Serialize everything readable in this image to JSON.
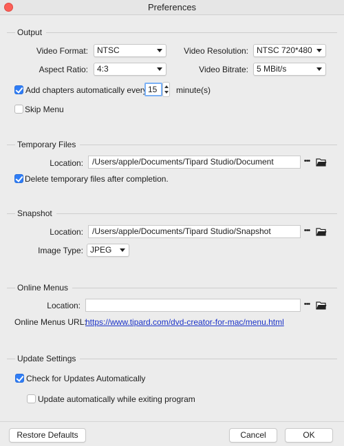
{
  "window": {
    "title": "Preferences"
  },
  "output": {
    "section_title": "Output",
    "video_format_label": "Video Format:",
    "video_format_value": "NTSC",
    "video_resolution_label": "Video Resolution:",
    "video_resolution_value": "NTSC 720*480",
    "aspect_ratio_label": "Aspect Ratio:",
    "aspect_ratio_value": "4:3",
    "video_bitrate_label": "Video Bitrate:",
    "video_bitrate_value": "5 MBit/s",
    "add_chapters_label": "Add chapters automatically every",
    "add_chapters_checked": true,
    "chapter_interval_value": "15",
    "minutes_label": "minute(s)",
    "skip_menu_label": "Skip Menu",
    "skip_menu_checked": false
  },
  "temporary_files": {
    "section_title": "Temporary Files",
    "location_label": "Location:",
    "location_value": "/Users/apple/Documents/Tipard Studio/Document",
    "delete_label": "Delete temporary files after completion.",
    "delete_checked": true
  },
  "snapshot": {
    "section_title": "Snapshot",
    "location_label": "Location:",
    "location_value": "/Users/apple/Documents/Tipard Studio/Snapshot",
    "image_type_label": "Image Type:",
    "image_type_value": "JPEG"
  },
  "online_menus": {
    "section_title": "Online Menus",
    "location_label": "Location:",
    "location_value": "",
    "url_label": "Online Menus URL:",
    "url_value": "https://www.tipard.com/dvd-creator-for-mac/menu.html"
  },
  "update_settings": {
    "section_title": "Update Settings",
    "check_updates_label": "Check for Updates Automatically",
    "check_updates_checked": true,
    "auto_update_label": "Update automatically while exiting program",
    "auto_update_checked": false
  },
  "buttons": {
    "browse_dots": "•••",
    "restore_defaults": "Restore Defaults",
    "cancel": "Cancel",
    "ok": "OK"
  },
  "colors": {
    "accent": "#2f7df6",
    "link": "#1a32c8",
    "close_button": "#fc5f57"
  }
}
